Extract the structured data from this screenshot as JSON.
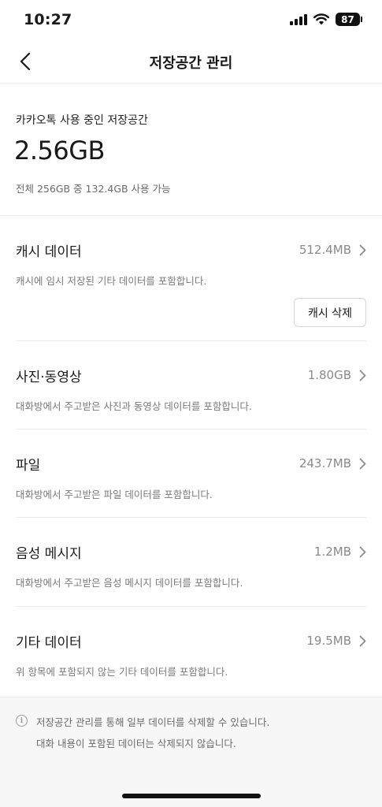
{
  "status": {
    "time": "10:27",
    "battery": "87"
  },
  "nav": {
    "title": "저장공간 관리"
  },
  "summary": {
    "label": "카카오톡 사용 중인 저장공간",
    "value": "2.56GB",
    "detail": "전체 256GB 중 132.4GB 사용 가능"
  },
  "categories": [
    {
      "name": "캐시 데이터",
      "size": "512.4MB",
      "description": "캐시에 임시 저장된 기타 데이터를 포함합니다.",
      "action": "캐시 삭제"
    },
    {
      "name": "사진·동영상",
      "size": "1.80GB",
      "description": "대화방에서 주고받은 사진과 동영상 데이터를 포함합니다."
    },
    {
      "name": "파일",
      "size": "243.7MB",
      "description": "대화방에서 주고받은 파일 데이터를 포함합니다."
    },
    {
      "name": "음성 메시지",
      "size": "1.2MB",
      "description": "대화방에서 주고받은 음성 메시지 데이터를 포함합니다."
    },
    {
      "name": "기타 데이터",
      "size": "19.5MB",
      "description": "위 항목에 포함되지 않는 기타 데이터를 포함합니다."
    }
  ],
  "footer": {
    "info_icon": "info-icon",
    "line1": "저장공간 관리를 통해 일부 데이터를 삭제할 수 있습니다.",
    "line2": "대화 내용이 포함된 데이터는 삭제되지 않습니다."
  }
}
